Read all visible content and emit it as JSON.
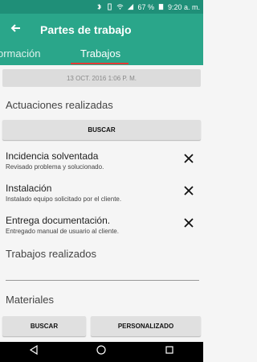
{
  "status": {
    "battery_percent": "67 %",
    "time": "9:20 a. m."
  },
  "toolbar": {
    "title": "Partes de trabajo"
  },
  "tabs": [
    {
      "label": "ormación"
    },
    {
      "label": "Trabajos"
    }
  ],
  "main": {
    "date": "13 OCT. 2016 1:06 P. M.",
    "actuaciones_title": "Actuaciones realizadas",
    "buscar_label": "BUSCAR",
    "items": [
      {
        "title": "Incidencia solventada",
        "subtitle": "Revisado problema y solucionado."
      },
      {
        "title": "Instalación",
        "subtitle": "Instalado equipo solicitado por el cliente."
      },
      {
        "title": "Entrega documentación.",
        "subtitle": "Entregado manual de usuario al cliente."
      }
    ],
    "trabajos_title": "Trabajos realizados",
    "materiales_title": "Materiales",
    "materiales_buscar_label": "BUSCAR",
    "personalizado_label": "PERSONALIZADO"
  },
  "icons": {
    "back": "arrow-left-icon",
    "close": "close-icon",
    "nav_back": "triangle-back-icon",
    "nav_home": "circle-home-icon",
    "nav_recent": "square-recent-icon"
  }
}
